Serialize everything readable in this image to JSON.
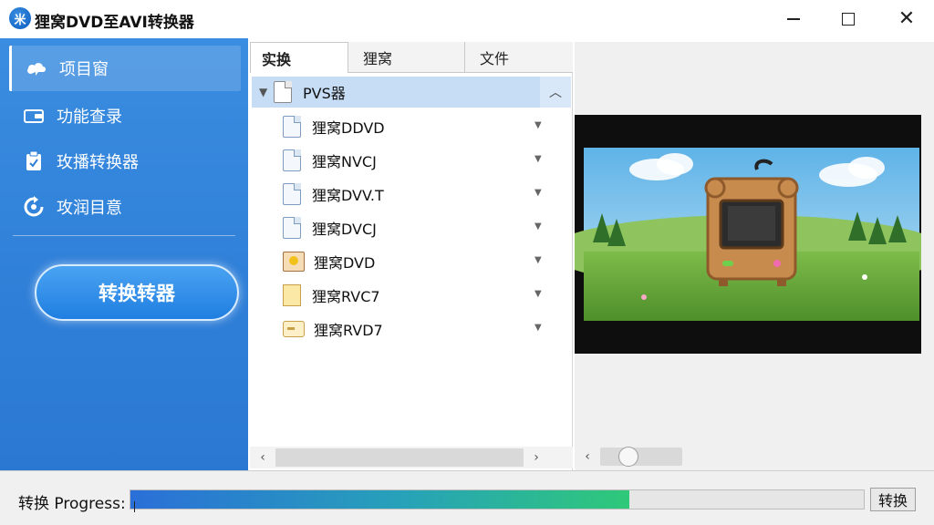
{
  "window": {
    "title": "狸窝DVD至AVI转换器",
    "logo_text": "米"
  },
  "sidebar": {
    "items": [
      {
        "label": "项目窗",
        "icon": "cloud-icon"
      },
      {
        "label": "功能查录",
        "icon": "wallet-icon"
      },
      {
        "label": "玫播转换器",
        "icon": "clipboard-check-icon"
      },
      {
        "label": "攻润目意",
        "icon": "refresh-icon"
      }
    ],
    "convert_button": "转换转器"
  },
  "file_pane": {
    "tabs": [
      "实换",
      "狸窝",
      "文件"
    ],
    "root": {
      "label": "PVS器"
    },
    "items": [
      {
        "label": "狸窝DDVD",
        "icon": "document-icon"
      },
      {
        "label": "狸窝NVCJ",
        "icon": "document-icon"
      },
      {
        "label": "狸窝DVV.T",
        "icon": "document-icon"
      },
      {
        "label": "狸窝DVCJ",
        "icon": "document-icon"
      },
      {
        "label": "狸窝DVD",
        "icon": "image-file-icon"
      },
      {
        "label": "狸窝RVC7",
        "icon": "note-file-icon"
      },
      {
        "label": "狸窝RVD7",
        "icon": "tag-file-icon"
      }
    ]
  },
  "preview": {
    "slider_value": 0.3
  },
  "progress": {
    "label": "转换 Progress:",
    "value": 0.68,
    "button": "转换"
  },
  "colors": {
    "sidebar_blue": "#2f7fd8",
    "selection_blue": "#c6ddf5",
    "progress_start": "#2a6fd8",
    "progress_end": "#2fc979"
  }
}
